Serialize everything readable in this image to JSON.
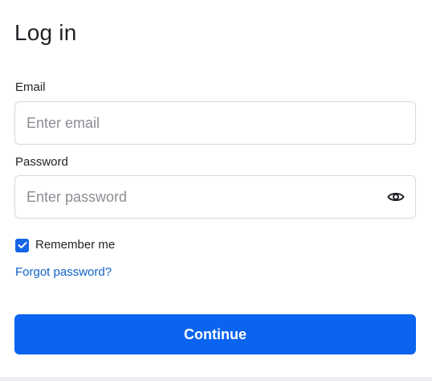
{
  "login": {
    "title": "Log in",
    "email": {
      "label": "Email",
      "placeholder": "Enter email",
      "value": ""
    },
    "password": {
      "label": "Password",
      "placeholder": "Enter password",
      "value": "",
      "toggle_icon": "eye-icon"
    },
    "remember": {
      "label": "Remember me",
      "checked": true,
      "icon": "checkmark-icon"
    },
    "forgot_link": "Forgot password?",
    "continue_label": "Continue"
  },
  "colors": {
    "primary": "#0a64f0",
    "link": "#0f62c8",
    "checkbox": "#1464e6",
    "text": "#1f2126",
    "placeholder": "#8b8e94",
    "border": "#d6d8dd"
  }
}
